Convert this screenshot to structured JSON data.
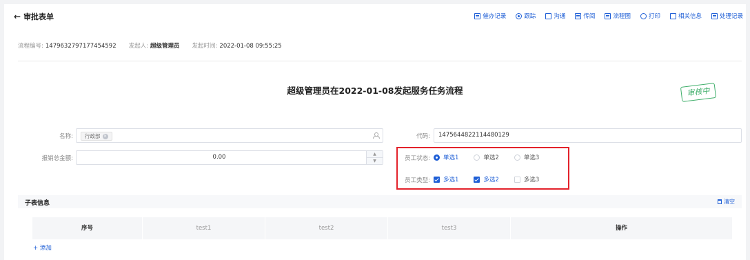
{
  "header": {
    "back_label": "审批表单",
    "toolbar": [
      {
        "label": "催办记录",
        "icon": "reminder-record-icon"
      },
      {
        "label": "跟踪",
        "icon": "track-icon"
      },
      {
        "label": "沟通",
        "icon": "communicate-icon"
      },
      {
        "label": "传阅",
        "icon": "circulate-icon"
      },
      {
        "label": "流程图",
        "icon": "flowchart-icon"
      },
      {
        "label": "打印",
        "icon": "print-icon"
      },
      {
        "label": "相关信息",
        "icon": "related-info-icon"
      },
      {
        "label": "处理记录",
        "icon": "process-record-icon"
      }
    ]
  },
  "meta": {
    "flow_no_label": "流程编号:",
    "flow_no": "1479632797177454592",
    "initiator_label": "发起人:",
    "initiator": "超级管理员",
    "time_label": "发起时间:",
    "time": "2022-01-08 09:55:25"
  },
  "title": "超级管理员在2022-01-08发起服务任务流程",
  "stamp": "审核中",
  "form": {
    "name_label": "名称:",
    "name_tag": "行政部",
    "code_label": "代码:",
    "code_value": "1475644822114480129",
    "amount_label": "报销总金额:",
    "amount_value": "0.00",
    "status_label": "员工状态:",
    "status_options": [
      {
        "label": "单选1",
        "checked": true
      },
      {
        "label": "单选2",
        "checked": false
      },
      {
        "label": "单选3",
        "checked": false
      }
    ],
    "type_label": "员工类型:",
    "type_options": [
      {
        "label": "多选1",
        "checked": true
      },
      {
        "label": "多选2",
        "checked": true
      },
      {
        "label": "多选3",
        "checked": false
      }
    ]
  },
  "subtable": {
    "title": "子表信息",
    "clear_label": "清空",
    "columns": [
      "序号",
      "test1",
      "test2",
      "test3",
      "操作"
    ],
    "add_label": "+ 添加"
  },
  "colors": {
    "accent": "#1f5fd6",
    "highlight": "#e3222b",
    "stamp": "#3fae6a"
  }
}
